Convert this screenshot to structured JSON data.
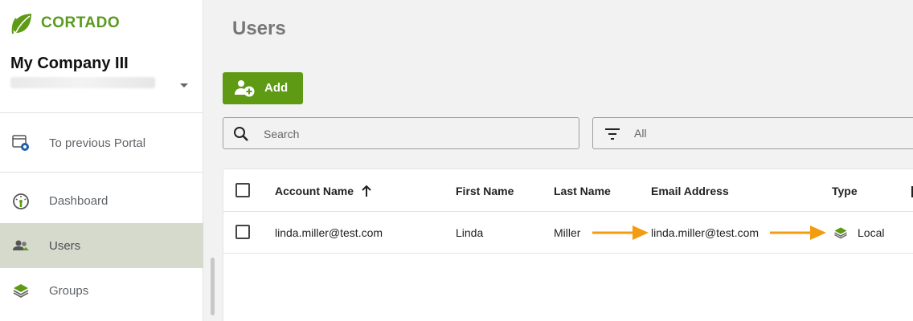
{
  "app": {
    "brand": "CORTADO"
  },
  "sidebar": {
    "company_name": "My Company III",
    "items": [
      {
        "label": "To previous Portal",
        "icon": "portal-gear-icon"
      },
      {
        "label": "Dashboard",
        "icon": "gauge-icon"
      },
      {
        "label": "Users",
        "icon": "users-icon",
        "active": true
      },
      {
        "label": "Groups",
        "icon": "layers-icon"
      }
    ]
  },
  "main": {
    "title": "Users",
    "add_label": "Add",
    "search": {
      "placeholder": "Search",
      "value": ""
    },
    "filter": {
      "value": "All"
    },
    "table": {
      "columns": [
        "Account Name",
        "First Name",
        "Last Name",
        "Email Address",
        "Type"
      ],
      "sort_column": "Account Name",
      "sort_direction": "ascending",
      "rows": [
        {
          "account": "linda.miller@test.com",
          "first": "Linda",
          "last": "Miller",
          "email": "linda.miller@test.com",
          "type": "Local"
        }
      ]
    }
  },
  "colors": {
    "brand_green": "#5e9a14",
    "arrow_orange": "#f39c12",
    "active_nav": "#d5dacc"
  }
}
